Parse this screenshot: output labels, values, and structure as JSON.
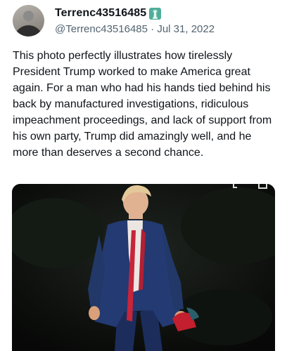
{
  "author": {
    "display_name": "Terrenc43516485",
    "handle": "@Terrenc43516485",
    "separator": "·",
    "date": "Jul 31, 2022"
  },
  "tweet": {
    "text": "This photo perfectly illustrates how tirelessly President Trump worked to make America great again. For a man who had his hands tied behind his back by manufactured investigations, ridiculous impeachment proceedings, and lack of support from his own party, Trump did amazingly well, and he more than deserves a second chance."
  },
  "icons": {
    "badge": "statue-of-liberty-icon",
    "media_controls": [
      "expand-icon",
      "close-icon"
    ]
  },
  "colors": {
    "text": "#0f1419",
    "secondary": "#536471",
    "badge": "#4fae9a",
    "photo_background": "#0b0d0c",
    "suit": "#233a72",
    "tie": "#c8243a"
  }
}
